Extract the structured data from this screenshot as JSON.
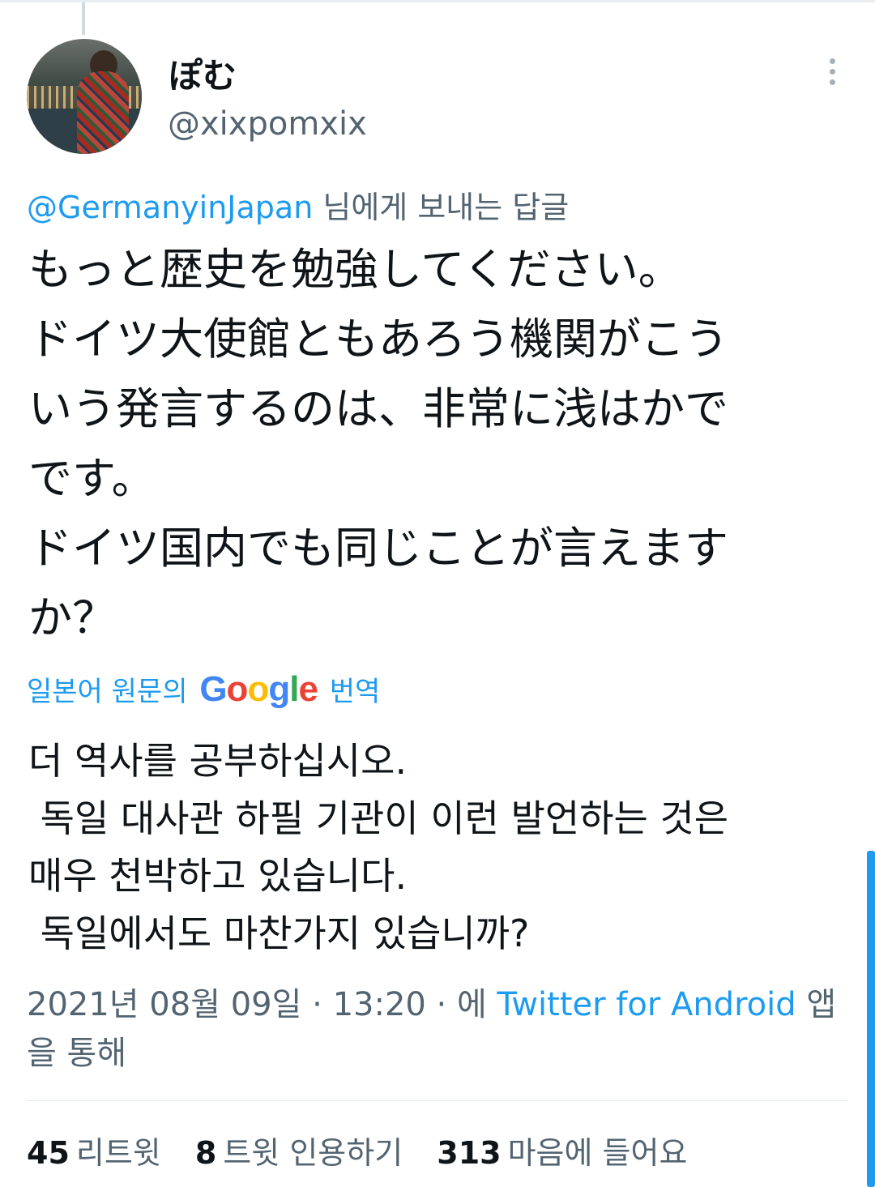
{
  "author": {
    "display_name": "ぽむ",
    "handle": "@xixpomxix"
  },
  "reply_to": {
    "mention": "@GermanyinJapan",
    "suffix": " 님에게 보내는 답글"
  },
  "tweet": {
    "text": "もっと歴史を勉強してください。\nドイツ大使館ともあろう機関がこう\nいう発言するのは、非常に浅はかで\nです。\nドイツ国内でも同じことが言えます\nか？"
  },
  "translation": {
    "prefix": "일본어 원문의",
    "google_letters": [
      "G",
      "o",
      "o",
      "g",
      "l",
      "e"
    ],
    "google_colors": [
      "#4285F4",
      "#EA4335",
      "#FBBC05",
      "#4285F4",
      "#34A853",
      "#EA4335"
    ],
    "suffix": "번역",
    "text": "더 역사를 공부하십시오.\n 독일 대사관 하필 기관이 이런 발언하는 것은\n매우 천박하고 있습니다.\n 독일에서도 마찬가지 있습니까?"
  },
  "meta": {
    "datetime": "2021년 08월 09일 · 13:20 · 에 ",
    "client": "Twitter for Android",
    "suffix": " 앱을 통해"
  },
  "stats": {
    "retweets_count": "45",
    "retweets_label": "리트윗",
    "quotes_count": "8",
    "quotes_label": "트윗 인용하기",
    "likes_count": "313",
    "likes_label": "마음에 들어요"
  },
  "icons": {
    "more": "more-vertical-icon"
  }
}
